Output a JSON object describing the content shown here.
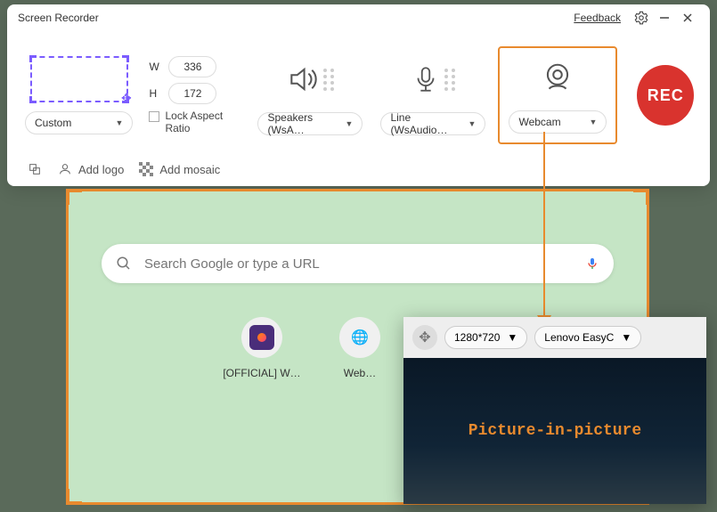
{
  "titlebar": {
    "title": "Screen Recorder",
    "feedback": "Feedback"
  },
  "capture": {
    "mode_label": "Custom",
    "width_label": "W",
    "width_value": "336",
    "height_label": "H",
    "height_value": "172",
    "lock_label": "Lock Aspect Ratio"
  },
  "audio": {
    "speaker_label": "Speakers (WsA…",
    "mic_label": "Line (WsAudio…"
  },
  "webcam": {
    "label": "Webcam"
  },
  "rec": {
    "label": "REC"
  },
  "toolbar": {
    "logo": "Add logo",
    "mosaic": "Add mosaic"
  },
  "browser": {
    "search_placeholder": "Search Google or type a URL",
    "shortcuts": [
      {
        "label": "[OFFICIAL] W…"
      },
      {
        "label": "Web…"
      },
      {
        "label": ""
      }
    ]
  },
  "pip": {
    "resolution": "1280*720",
    "device": "Lenovo EasyC",
    "overlay": "Picture-in-picture"
  }
}
